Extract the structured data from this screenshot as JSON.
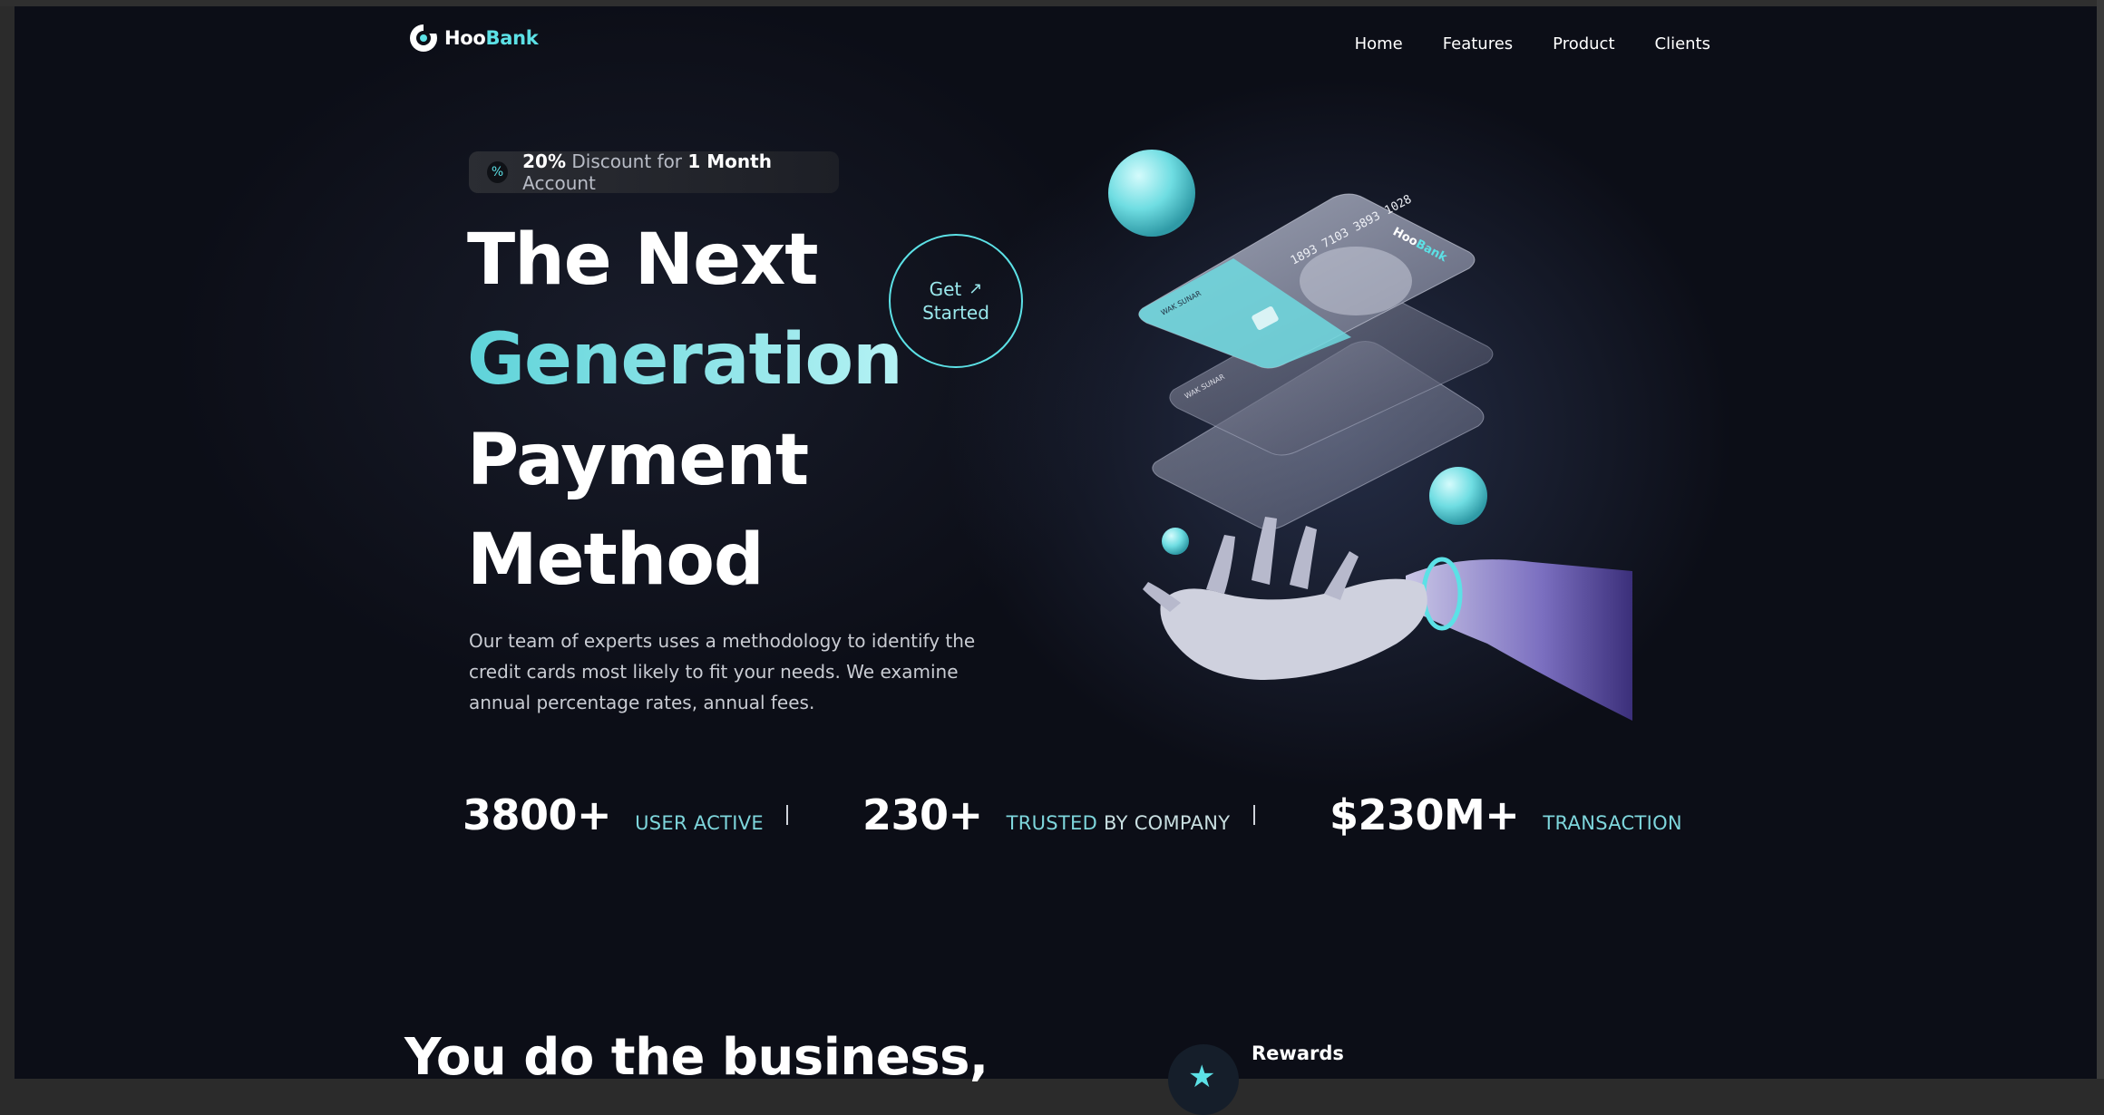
{
  "brand": {
    "part1": "Hoo",
    "part2": "Bank"
  },
  "nav": {
    "items": [
      "Home",
      "Features",
      "Product",
      "Clients"
    ]
  },
  "badge": {
    "bold1": "20%",
    "text1": " Discount for ",
    "bold2": "1 Month",
    "text2": " Account"
  },
  "hero": {
    "line1": "The Next",
    "line2": "Generation",
    "line3": "Payment",
    "line4": "Method",
    "cta_line1": "Get",
    "cta_line2": "Started",
    "description": "Our team of experts uses a methodology to identify the credit cards most likely to fit your needs. We examine annual percentage rates, annual fees."
  },
  "card": {
    "number": "1893 7103 3893 1028",
    "name": "WAK SUNAR"
  },
  "stats": [
    {
      "value": "3800+",
      "label_a": "USER ACTIVE",
      "label_b": ""
    },
    {
      "value": "230+",
      "label_a": "TRUSTED",
      "label_b": " BY COMPANY"
    },
    {
      "value": "$230M+",
      "label_a": "TRANSACTION",
      "label_b": ""
    }
  ],
  "section2": {
    "heading": "You do the business,",
    "feature1": "Rewards"
  },
  "colors": {
    "accent": "#5ce1e6",
    "background": "#0c0e17"
  }
}
